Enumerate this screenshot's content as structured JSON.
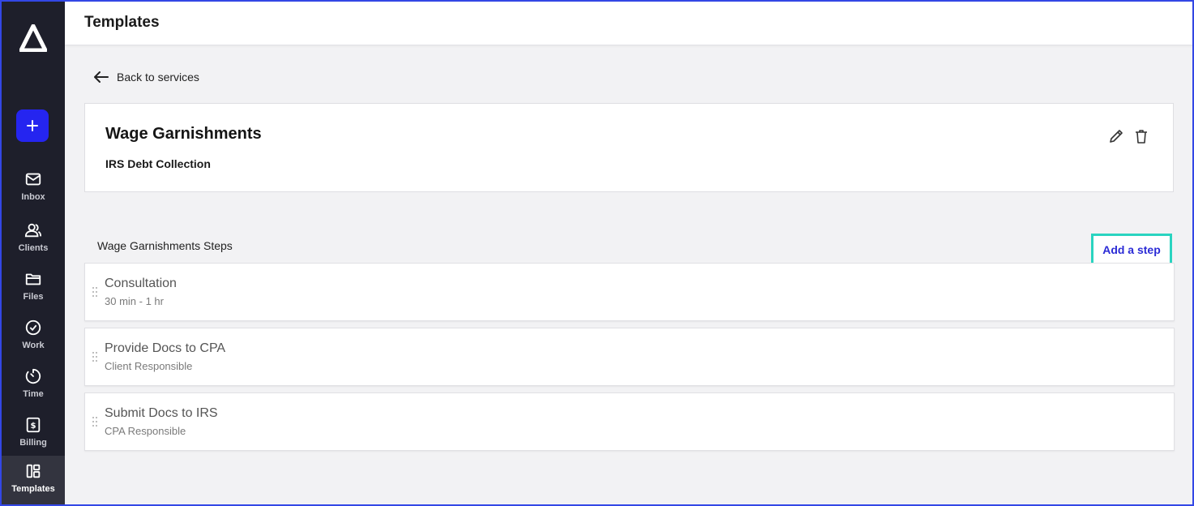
{
  "nav": {
    "items": [
      {
        "label": "Inbox",
        "icon": "mail-icon"
      },
      {
        "label": "Clients",
        "icon": "users-icon"
      },
      {
        "label": "Files",
        "icon": "folder-icon"
      },
      {
        "label": "Work",
        "icon": "check-circle-icon"
      },
      {
        "label": "Time",
        "icon": "clock-icon"
      },
      {
        "label": "Billing",
        "icon": "dollar-icon"
      },
      {
        "label": "Templates",
        "icon": "templates-icon",
        "active": true
      }
    ]
  },
  "header": {
    "title": "Templates"
  },
  "back": {
    "label": "Back to services"
  },
  "service": {
    "name": "Wage Garnishments",
    "category": "IRS Debt Collection"
  },
  "steps_section": {
    "title": "Wage Garnishments Steps",
    "add_label": "Add a step",
    "steps": [
      {
        "title": "Consultation",
        "detail": "30 min - 1 hr"
      },
      {
        "title": "Provide Docs to CPA",
        "detail": "Client Responsible"
      },
      {
        "title": "Submit Docs to IRS",
        "detail": "CPA Responsible"
      }
    ]
  },
  "colors": {
    "sidebar": "#1e1f2b",
    "accent": "#2525f0",
    "highlight": "#2ad4c0"
  }
}
